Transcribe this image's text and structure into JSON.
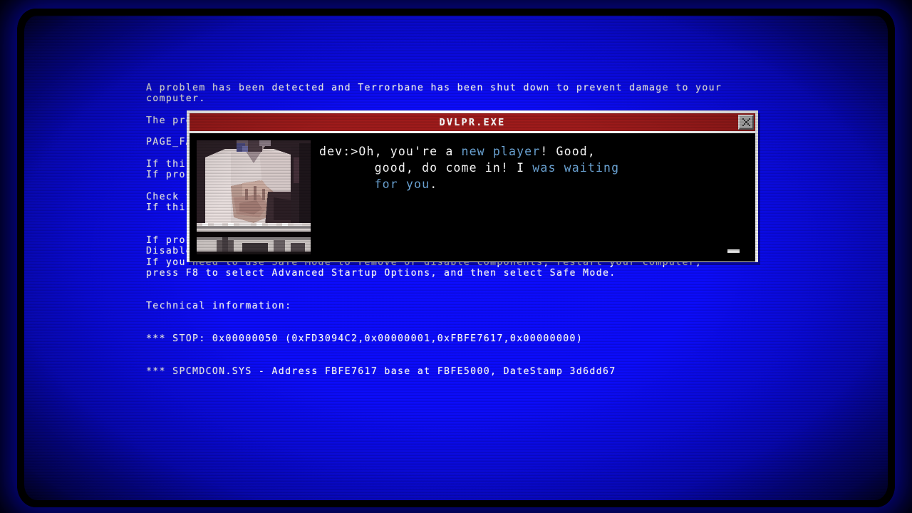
{
  "screen": {
    "background_color": "#0a0aff",
    "text_color": "#ffffff",
    "effect": "crt-scanlines"
  },
  "bsod": {
    "lines": [
      "A problem has been detected and Terrorbane has been shut down to prevent damage to your",
      "computer.",
      "",
      "The problem seems to be caused by the following file: SPCMDCON.SYS",
      "",
      "PAGE_FAULT_IN_NONPAGED_AREA",
      "",
      "If this is the first time you've seen this Stop error screen,",
      "If problems continue, disable or remove any newly installed hardware or software.",
      "",
      "Check to be sure you have adequate disk space.",
      "If this is a new installation, ask your hardware or software manufacturer for updates.",
      "",
      "",
      "If problems continue, disable or remove any newly installed hardware or software.",
      "Disable BIOS memory options such as caching or shadowing.",
      "If you need to use Safe Mode to remove or disable components, restart your computer,",
      "press F8 to select Advanced Startup Options, and then select Safe Mode.",
      "",
      "",
      "Technical information:",
      "",
      "",
      "*** STOP: 0x00000050 (0xFD3094C2,0x00000001,0xFBFE7617,0x00000000)",
      "",
      "",
      "*** SPCMDCON.SYS - Address FBFE7617 base at FBFE5000, DateStamp 3d6dd67"
    ]
  },
  "dialog": {
    "title": "DVLPR.EXE",
    "titlebar_color": "#9e1b1b",
    "close_button": {
      "label": "x",
      "icon": "close-icon"
    },
    "portrait": {
      "icon": "developer-portrait",
      "description": "pixelated photo of a person in a white shirt with folded hands at a desk"
    },
    "speaker_prompt": "dev:>",
    "message_segments": [
      {
        "text": "Oh, you're a ",
        "highlight": false
      },
      {
        "text": "new player",
        "highlight": true
      },
      {
        "text": "! Good,\n       good, do come in! ",
        "highlight": false
      },
      {
        "text": "I",
        "highlight": false
      },
      {
        "text": " was waiting",
        "highlight": true
      },
      {
        "text": "\n       ",
        "highlight": false
      },
      {
        "text": "for you",
        "highlight": true
      },
      {
        "text": ".",
        "highlight": false
      }
    ],
    "highlight_color": "#6ea8da",
    "continue_indicator": "-"
  }
}
